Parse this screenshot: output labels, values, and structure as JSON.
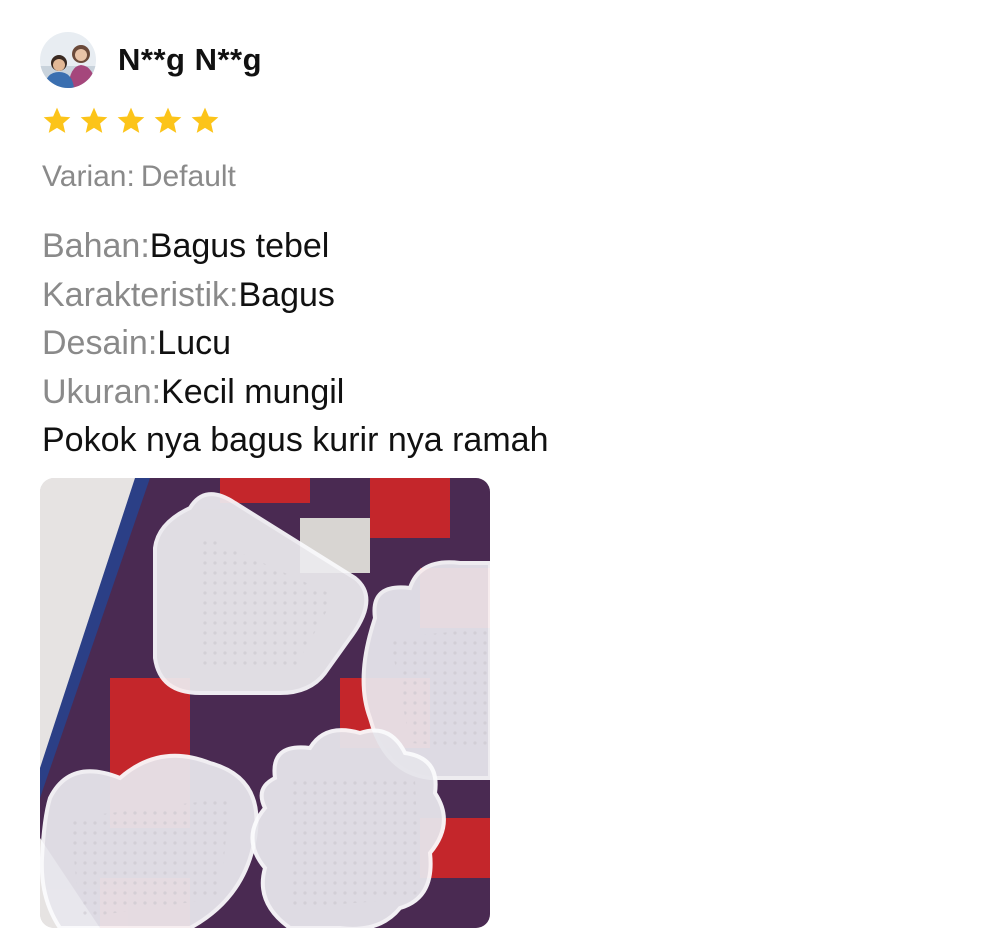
{
  "review": {
    "username": "N**g N**g",
    "rating": 5,
    "rating_max": 5,
    "variant_label": "Varian:",
    "variant_value": "Default",
    "attributes": [
      {
        "label": "Bahan:",
        "value": "Bagus tebel"
      },
      {
        "label": "Karakteristik:",
        "value": "Bagus"
      },
      {
        "label": "Desain:",
        "value": "Lucu"
      },
      {
        "label": "Ukuran:",
        "value": "Kecil mungil"
      }
    ],
    "comment": "Pokok nya bagus kurir nya ramah"
  },
  "colors": {
    "star": "#fcc419",
    "label_gray": "#8a8a8a",
    "text_dark": "#111111"
  }
}
